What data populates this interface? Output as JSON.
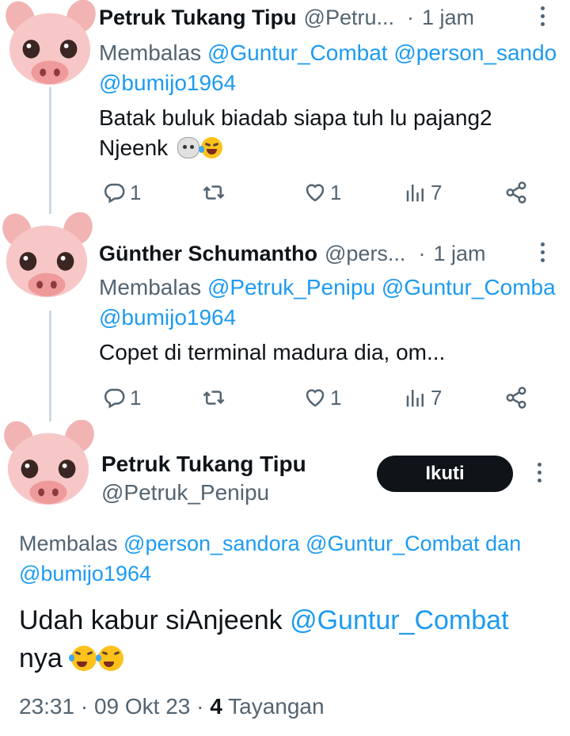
{
  "replies": [
    {
      "name": "Petruk Tukang Tipu",
      "handle": "@Petru...",
      "dot": "·",
      "time": "1 jam",
      "reply_prefix": "Membalas ",
      "reply_mentions": [
        "@Guntur_Combat",
        "@person_sando"
      ],
      "reply_mentions_line2": "@bumijo1964",
      "text_line1": "Batak buluk biadab siapa tuh lu pajang2",
      "text_line2": "Njeenk",
      "reply_count": "1",
      "like_count": "1",
      "view_count": "7"
    },
    {
      "name": "Günther Schumantho",
      "handle": "@pers...",
      "dot": "·",
      "time": "1 jam",
      "reply_prefix": "Membalas ",
      "reply_mentions": [
        "@Petruk_Penipu",
        "@Guntur_Comba"
      ],
      "reply_mentions_line2": "@bumijo1964",
      "text_line1": "Copet di terminal madura dia, om...",
      "reply_count": "1",
      "like_count": "1",
      "view_count": "7"
    }
  ],
  "main": {
    "name": "Petruk Tukang Tipu",
    "handle": "@Petruk_Penipu",
    "follow_label": "Ikuti",
    "reply_prefix": "Membalas ",
    "reply_mention1": "@person_sandora",
    "reply_mention2": "@Guntur_Combat",
    "reply_and": "dan",
    "reply_mention3": "@bumijo1964",
    "text_before": "Udah kabur siAnjeenk ",
    "text_mention": "@Guntur_Combat",
    "text_after": "nya",
    "time": "23:31",
    "sep": "·",
    "date": "09 Okt 23",
    "views": "4",
    "views_label": "Tayangan"
  },
  "colors": {
    "accent": "#1d9bf0",
    "secondary_text": "#536471",
    "primary_text": "#0f1419",
    "button_bg": "#0f1419"
  },
  "icons": [
    "reply-icon",
    "retweet-icon",
    "like-icon",
    "views-icon",
    "share-icon",
    "more-icon",
    "pig-avatar"
  ]
}
